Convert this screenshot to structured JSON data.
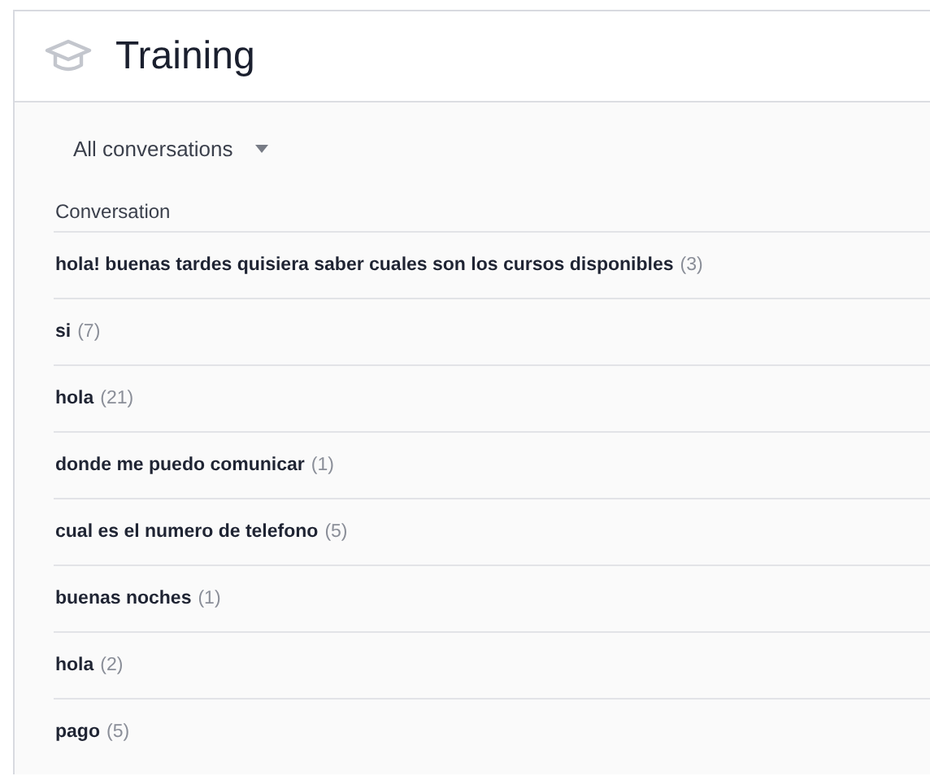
{
  "header": {
    "title": "Training"
  },
  "filter": {
    "value": "All conversations"
  },
  "table": {
    "column": "Conversation",
    "rows": [
      {
        "text": "hola! buenas tardes quisiera saber cuales son los cursos disponibles",
        "count": "(3)"
      },
      {
        "text": "si",
        "count": "(7)"
      },
      {
        "text": "hola",
        "count": "(21)"
      },
      {
        "text": "donde me puedo comunicar",
        "count": "(1)"
      },
      {
        "text": "cual es el numero de telefono",
        "count": "(5)"
      },
      {
        "text": "buenas noches",
        "count": "(1)"
      },
      {
        "text": "hola",
        "count": "(2)"
      },
      {
        "text": "pago",
        "count": "(5)"
      }
    ]
  }
}
